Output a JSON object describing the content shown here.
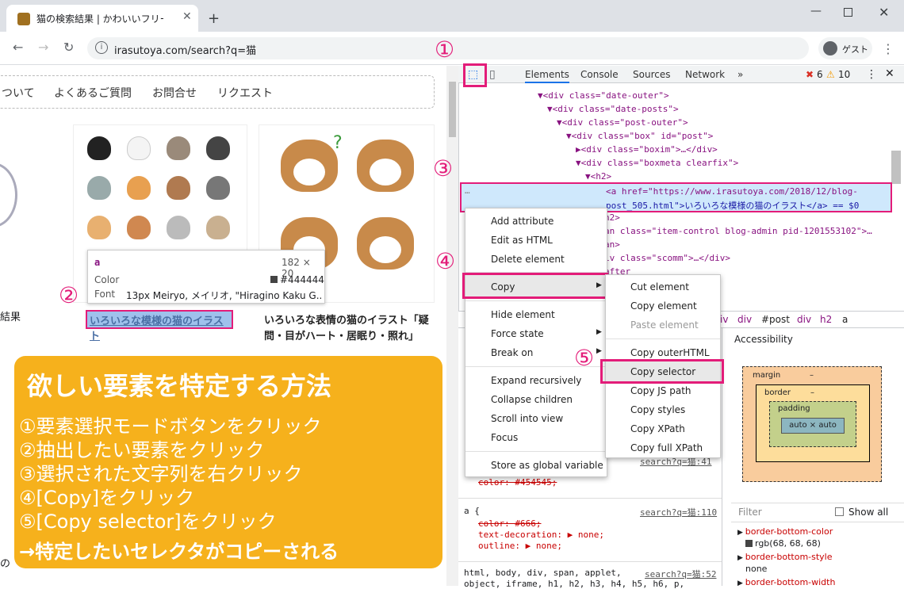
{
  "browser": {
    "tab_title": "猫の検索結果 | かわいいフリー素材集",
    "url": "irasutoya.com/search?q=猫",
    "profile_label": "ゲスト"
  },
  "site_nav": [
    "ついて",
    "よくあるご質問",
    "お問合せ",
    "リクエスト"
  ],
  "tooltip": {
    "tag": "a",
    "size": "182 × 20",
    "color_label": "Color",
    "color_value": "#444444",
    "font_label": "Font",
    "font_value": "13px Meiryo, メイリオ, \"Hiragino Kaku G..."
  },
  "cards": [
    {
      "title": "いろいろな模様の猫のイラスト"
    },
    {
      "title_line1": "いろいろな表情の猫のイラスト「疑",
      "title_line2": "問・目がハート・居眠り・照れ」"
    }
  ],
  "left_fragment": "結果",
  "left_fragment2": "の",
  "instructions": {
    "heading": "欲しい要素を特定する方法",
    "steps": [
      "①要素選択モードボタンをクリック",
      "②抽出したい要素をクリック",
      "③選択された文字列を右クリック",
      "④[Copy]をクリック",
      "⑤[Copy selector]をクリック"
    ],
    "result": "→特定したいセレクタがコピーされる"
  },
  "markers": [
    "①",
    "②",
    "③",
    "④",
    "⑤"
  ],
  "devtools": {
    "tabs": [
      "Elements",
      "Console",
      "Sources",
      "Network",
      "»"
    ],
    "errors": "6",
    "warnings": "10",
    "dom_lines": [
      {
        "indent": 0,
        "html": "▼<div class=\"date-outer\">"
      },
      {
        "indent": 1,
        "html": "▼<div class=\"date-posts\">"
      },
      {
        "indent": 2,
        "html": "▼<div class=\"post-outer\">"
      },
      {
        "indent": 3,
        "html": "▼<div class=\"box\" id=\"post\">"
      },
      {
        "indent": 4,
        "html": "▶<div class=\"boxim\">…</div>"
      },
      {
        "indent": 4,
        "html": "▼<div class=\"boxmeta clearfix\">"
      },
      {
        "indent": 5,
        "html": "▼<h2>"
      }
    ],
    "selected_line1": "<a href=\"https://www.irasutoya.com/2018/12/blog-",
    "selected_line2": "post_505.html\">いろいろな模様の猫のイラスト</a> == $0",
    "after_lines": [
      "h2>",
      "an class=\"item-control blog-admin pid-1201553102\">…",
      "an>",
      "iv class=\"scomm\">…</div>",
      "after"
    ],
    "crumbs": [
      "iv",
      "div",
      "#post",
      "div",
      "h2",
      "a"
    ],
    "context_menu": [
      "Add attribute",
      "Edit as HTML",
      "Delete element",
      "Copy",
      "Hide element",
      "Force state",
      "Break on",
      "Expand recursively",
      "Collapse children",
      "Scroll into view",
      "Focus",
      "Store as global variable"
    ],
    "copy_submenu": [
      "Cut element",
      "Copy element",
      "Paste element",
      "Copy outerHTML",
      "Copy selector",
      "Copy JS path",
      "Copy styles",
      "Copy XPath",
      "Copy full XPath"
    ],
    "accessibility": "Accessibility",
    "boxmodel": {
      "margin": "margin",
      "border": "border",
      "padding": "padding",
      "content": "auto × auto",
      "dash": "–"
    },
    "filter": "Filter",
    "show_all": "Show all",
    "computed": [
      "border-bottom-color",
      "rgb(68, 68, 68)",
      "border-bottom-style",
      "none",
      "border-bottom-width"
    ],
    "styles": {
      "src1": "search?q=猫:41",
      "color1": "color: #454545;",
      "rule2": "a {",
      "src2": "search?q=猫:110",
      "color2": "color: #666;",
      "deco": "text-decoration: ▶ none;",
      "outline": "outline: ▶ none;",
      "rule3": "html, body, div, span, applet,",
      "src3": "search?q=猫:52",
      "rule3b": "object, iframe, h1, h2, h3, h4, h5, h6, p,"
    }
  }
}
